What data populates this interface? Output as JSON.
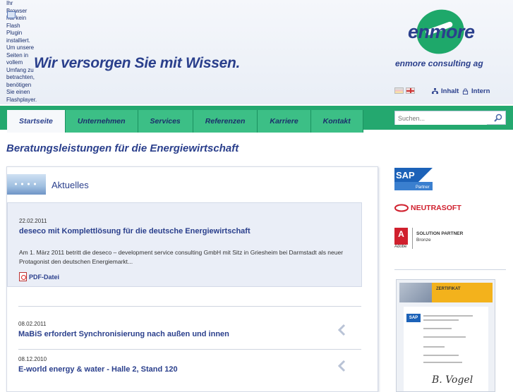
{
  "header": {
    "flash_note": "Ihr Browser hat kein Flash Plugin installiert. Um unsere Seiten in vollem Umfang zu betrachten, benötigen Sie einen Flashplayer.",
    "tagline": "Wir versorgen Sie mit Wissen.",
    "logo_text": "enmore",
    "logo_sub": "enmore consulting ag",
    "links": {
      "inhalt": "Inhalt",
      "intern": "Intern"
    }
  },
  "nav": {
    "tabs": [
      "Startseite",
      "Unternehmen",
      "Services",
      "Referenzen",
      "Karriere",
      "Kontakt"
    ],
    "active": "Startseite"
  },
  "search": {
    "placeholder": "Suchen..."
  },
  "main": {
    "page_title": "Beratungsleistungen für die Energiewirtschaft",
    "news_heading": "Aktuelles",
    "items": [
      {
        "date": "22.02.2011",
        "title": "deseco mit Komplettlösung für die deutsche Energiewirtschaft",
        "text": "Am 1. März 2011 betritt die deseco – development service consulting GmbH mit Sitz in Griesheim bei Darmstadt als neuer Protagonist den deutschen Energiemarkt...",
        "pdf": "PDF-Datei"
      },
      {
        "date": "08.02.2011",
        "title": "MaBiS erfordert Synchronisierung nach außen und innen"
      },
      {
        "date": "08.12.2010",
        "title": "E-world energy & water - Halle 2, Stand 120"
      }
    ]
  },
  "sidebar": {
    "sap": "SAP",
    "sap_badge": "Partner",
    "neutrasoft": "NEUTRASOFT",
    "adobe_letter": "A",
    "adobe_line1": "SOLUTION PARTNER",
    "adobe_line2": "Bronze",
    "adobe_caption": "Adobe",
    "cert_title": "ZERTIFIKAT",
    "cert_sap": "SAP"
  },
  "colors": {
    "brand_blue": "#2a3f8c",
    "brand_green": "#24a86f"
  }
}
